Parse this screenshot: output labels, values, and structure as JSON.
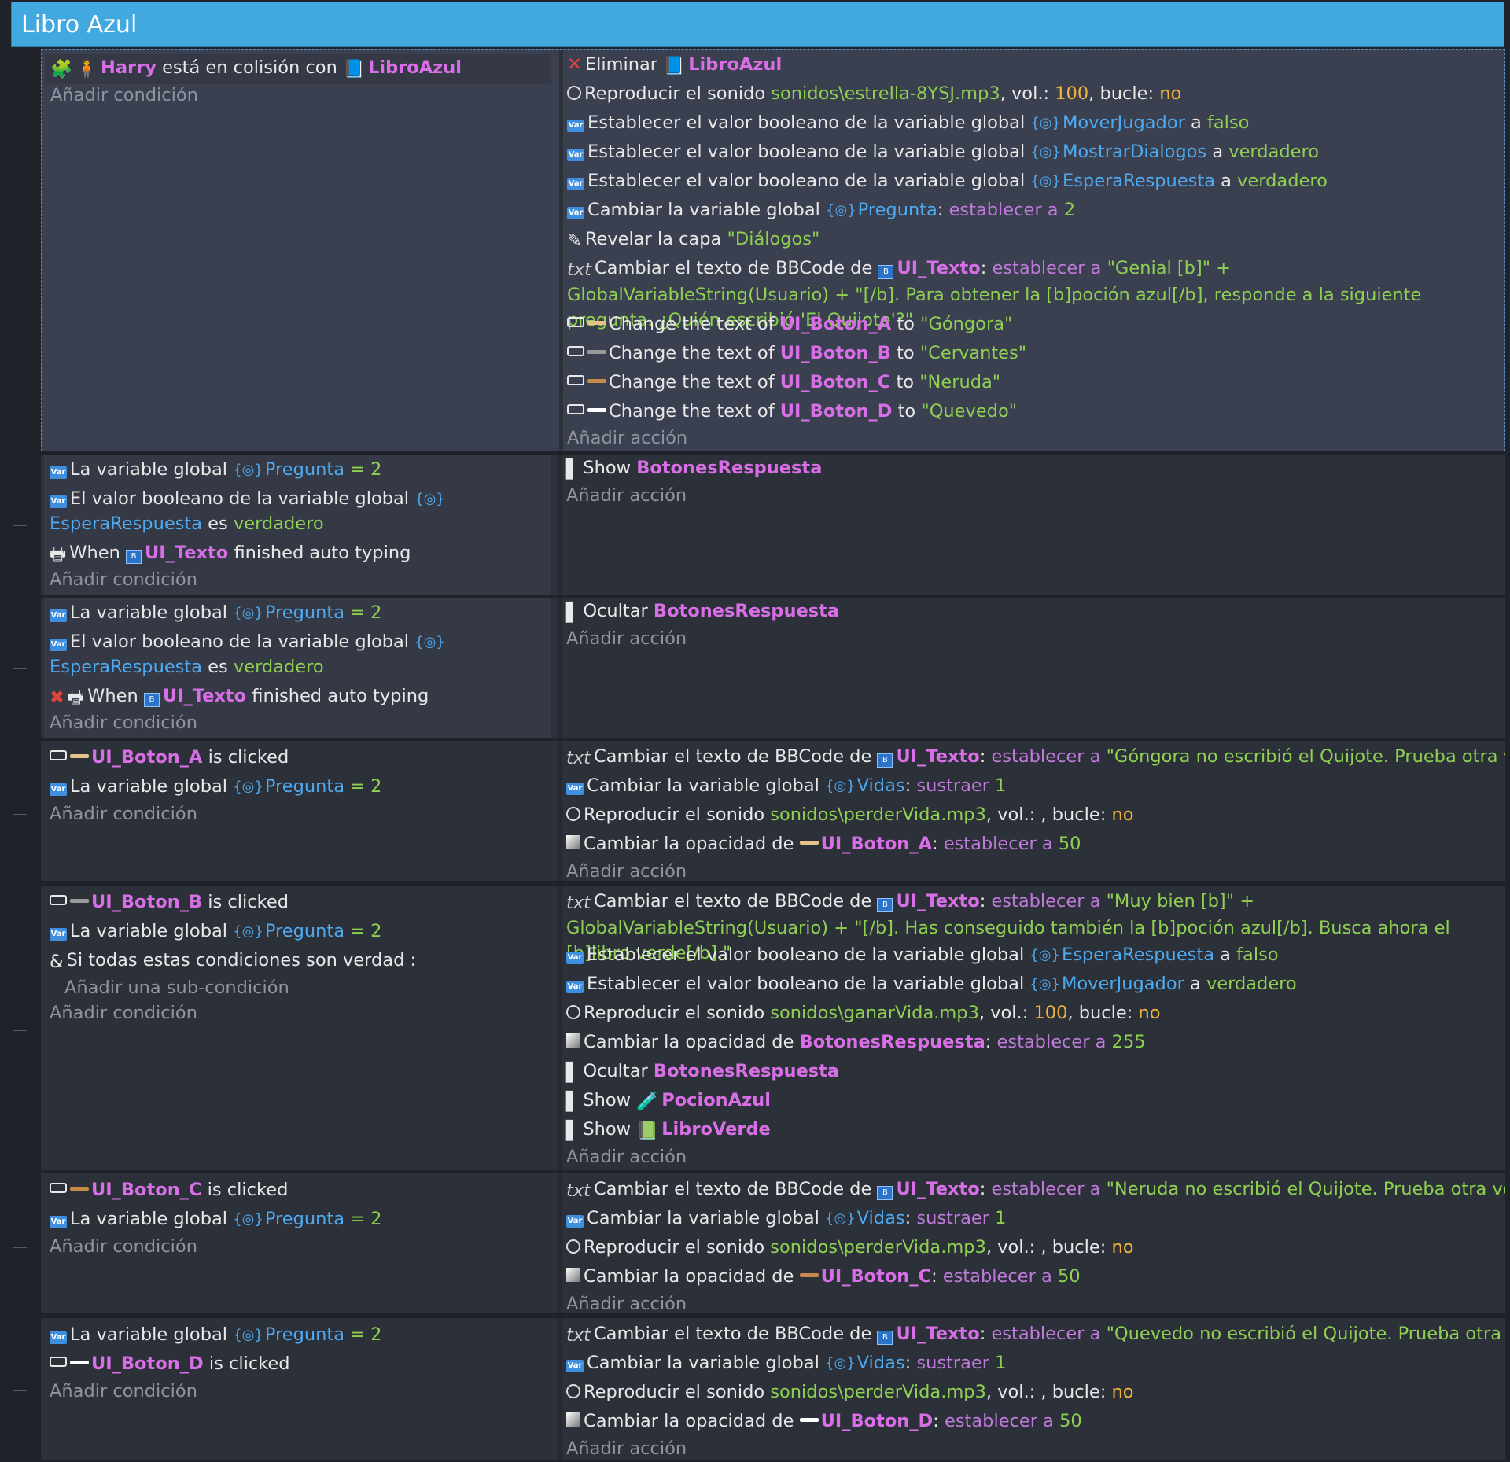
{
  "group": {
    "title": "Libro Azul"
  },
  "labels": {
    "add_condition": "Añadir condición",
    "add_action": "Añadir acción",
    "add_subcondition": "Añadir una sub-condición"
  },
  "ev1": {
    "c1": {
      "obj1": "Harry",
      "text": "está en colisión con",
      "obj2": "LibroAzul"
    },
    "a1": {
      "text": "Eliminar",
      "obj": "LibroAzul"
    },
    "a2": {
      "text": "Reproducir el sonido",
      "file": "sonidos\\estrella-8YSJ.mp3",
      "vol_label": ", vol.:",
      "vol": "100",
      "loop_label": ", bucle:",
      "loop": "no"
    },
    "a3": {
      "text": "Establecer el valor booleano de la variable global",
      "var": "MoverJugador",
      "a": "a",
      "val": "falso"
    },
    "a4": {
      "text": "Establecer el valor booleano de la variable global",
      "var": "MostrarDialogos",
      "a": "a",
      "val": "verdadero"
    },
    "a5": {
      "text": "Establecer el valor booleano de la variable global",
      "var": "EsperaRespuesta",
      "a": "a",
      "val": "verdadero"
    },
    "a6": {
      "text": "Cambiar la variable global",
      "var": "Pregunta",
      "op": "establecer a",
      "val": "2"
    },
    "a7": {
      "text": "Revelar la capa",
      "val": "\"Diálogos\""
    },
    "a8": {
      "text": "Cambiar el texto de BBCode de",
      "obj": "UI_Texto",
      "op": "establecer a",
      "val": "\"Genial [b]\" + GlobalVariableString(Usuario) + \"[/b]. Para obtener la [b]poción azul[/b], responde a la siguiente pregunta. ¿Quién escribió 'El Quijote'?\""
    },
    "a9": {
      "text": "Change the text of",
      "obj": "UI_Boton_A",
      "to": "to",
      "val": "\"Góngora\""
    },
    "a10": {
      "text": "Change the text of",
      "obj": "UI_Boton_B",
      "to": "to",
      "val": "\"Cervantes\""
    },
    "a11": {
      "text": "Change the text of",
      "obj": "UI_Boton_C",
      "to": "to",
      "val": "\"Neruda\""
    },
    "a12": {
      "text": "Change the text of",
      "obj": "UI_Boton_D",
      "to": "to",
      "val": "\"Quevedo\""
    }
  },
  "ev2": {
    "c1": {
      "text": "La variable global",
      "var": "Pregunta",
      "eq": "=",
      "val": "2"
    },
    "c2": {
      "text": "El valor booleano de la variable global",
      "var": "EsperaRespuesta",
      "es": "es",
      "val": "verdadero"
    },
    "c3": {
      "when": "When",
      "obj": "UI_Texto",
      "text": "finished auto typing"
    },
    "a1": {
      "text": "Show",
      "obj": "BotonesRespuesta"
    }
  },
  "ev3": {
    "c1": {
      "text": "La variable global",
      "var": "Pregunta",
      "eq": "=",
      "val": "2"
    },
    "c2": {
      "text": "El valor booleano de la variable global",
      "var": "EsperaRespuesta",
      "es": "es",
      "val": "verdadero"
    },
    "c3": {
      "when": "When",
      "obj": "UI_Texto",
      "text": "finished auto typing"
    },
    "a1": {
      "text": "Ocultar",
      "obj": "BotonesRespuesta"
    }
  },
  "ev4": {
    "c1": {
      "obj": "UI_Boton_A",
      "text": "is clicked"
    },
    "c2": {
      "text": "La variable global",
      "var": "Pregunta",
      "eq": "=",
      "val": "2"
    },
    "a1": {
      "text": "Cambiar el texto de BBCode de",
      "obj": "UI_Texto",
      "op": "establecer a",
      "val": "\"Góngora no escribió el Quijote. Prueba otra vez.\""
    },
    "a2": {
      "text": "Cambiar la variable global",
      "var": "Vidas",
      "op": "sustraer",
      "val": "1"
    },
    "a3": {
      "text": "Reproducir el sonido",
      "file": "sonidos\\perderVida.mp3",
      "vol_label": ", vol.: , bucle:",
      "loop": "no"
    },
    "a4": {
      "text": "Cambiar la opacidad de",
      "obj": "UI_Boton_A",
      "op": "establecer a",
      "val": "50"
    }
  },
  "ev5": {
    "c1": {
      "obj": "UI_Boton_B",
      "text": "is clicked"
    },
    "c2": {
      "text": "La variable global",
      "var": "Pregunta",
      "eq": "=",
      "val": "2"
    },
    "c3": {
      "text": "Si todas estas condiciones son verdad :"
    },
    "a1": {
      "text": "Cambiar el texto de BBCode de",
      "obj": "UI_Texto",
      "op": "establecer a",
      "val": "\"Muy bien [b]\" + GlobalVariableString(Usuario) + \"[/b]. Has conseguido también la [b]poción azul[/b]. Busca ahora el [b]libro verde[/b].\""
    },
    "a2": {
      "text": "Establecer el valor booleano de la variable global",
      "var": "EsperaRespuesta",
      "a": "a",
      "val": "falso"
    },
    "a3": {
      "text": "Establecer el valor booleano de la variable global",
      "var": "MoverJugador",
      "a": "a",
      "val": "verdadero"
    },
    "a4": {
      "text": "Reproducir el sonido",
      "file": "sonidos\\ganarVida.mp3",
      "vol_label": ", vol.:",
      "vol": "100",
      "loop_label": ", bucle:",
      "loop": "no"
    },
    "a5": {
      "text": "Cambiar la opacidad de",
      "obj": "BotonesRespuesta",
      "op": "establecer a",
      "val": "255"
    },
    "a6": {
      "text": "Ocultar",
      "obj": "BotonesRespuesta"
    },
    "a7": {
      "text": "Show",
      "obj": "PocionAzul"
    },
    "a8": {
      "text": "Show",
      "obj": "LibroVerde"
    }
  },
  "ev6": {
    "c1": {
      "obj": "UI_Boton_C",
      "text": "is clicked"
    },
    "c2": {
      "text": "La variable global",
      "var": "Pregunta",
      "eq": "=",
      "val": "2"
    },
    "a1": {
      "text": "Cambiar el texto de BBCode de",
      "obj": "UI_Texto",
      "op": "establecer a",
      "val": "\"Neruda no escribió el Quijote. Prueba otra vez.\""
    },
    "a2": {
      "text": "Cambiar la variable global",
      "var": "Vidas",
      "op": "sustraer",
      "val": "1"
    },
    "a3": {
      "text": "Reproducir el sonido",
      "file": "sonidos\\perderVida.mp3",
      "vol_label": ", vol.: , bucle:",
      "loop": "no"
    },
    "a4": {
      "text": "Cambiar la opacidad de",
      "obj": "UI_Boton_C",
      "op": "establecer a",
      "val": "50"
    }
  },
  "ev7": {
    "c1": {
      "text": "La variable global",
      "var": "Pregunta",
      "eq": "=",
      "val": "2"
    },
    "c2": {
      "obj": "UI_Boton_D",
      "text": "is clicked"
    },
    "a1": {
      "text": "Cambiar el texto de BBCode de",
      "obj": "UI_Texto",
      "op": "establecer a",
      "val": "\"Quevedo no escribió el Quijote. Prueba otra vez.\""
    },
    "a2": {
      "text": "Cambiar la variable global",
      "var": "Vidas",
      "op": "sustraer",
      "val": "1"
    },
    "a3": {
      "text": "Reproducir el sonido",
      "file": "sonidos\\perderVida.mp3",
      "vol_label": ", vol.: , bucle:",
      "loop": "no"
    },
    "a4": {
      "text": "Cambiar la opacidad de",
      "obj": "UI_Boton_D",
      "op": "establecer a",
      "val": "50"
    }
  },
  "icons": {
    "boton_a_color": "#e6c28a",
    "boton_b_color": "#9a9a9a",
    "boton_c_color": "#c78a4a",
    "boton_d_color": "#ffffff",
    "brand_header": "#41a9e0"
  }
}
